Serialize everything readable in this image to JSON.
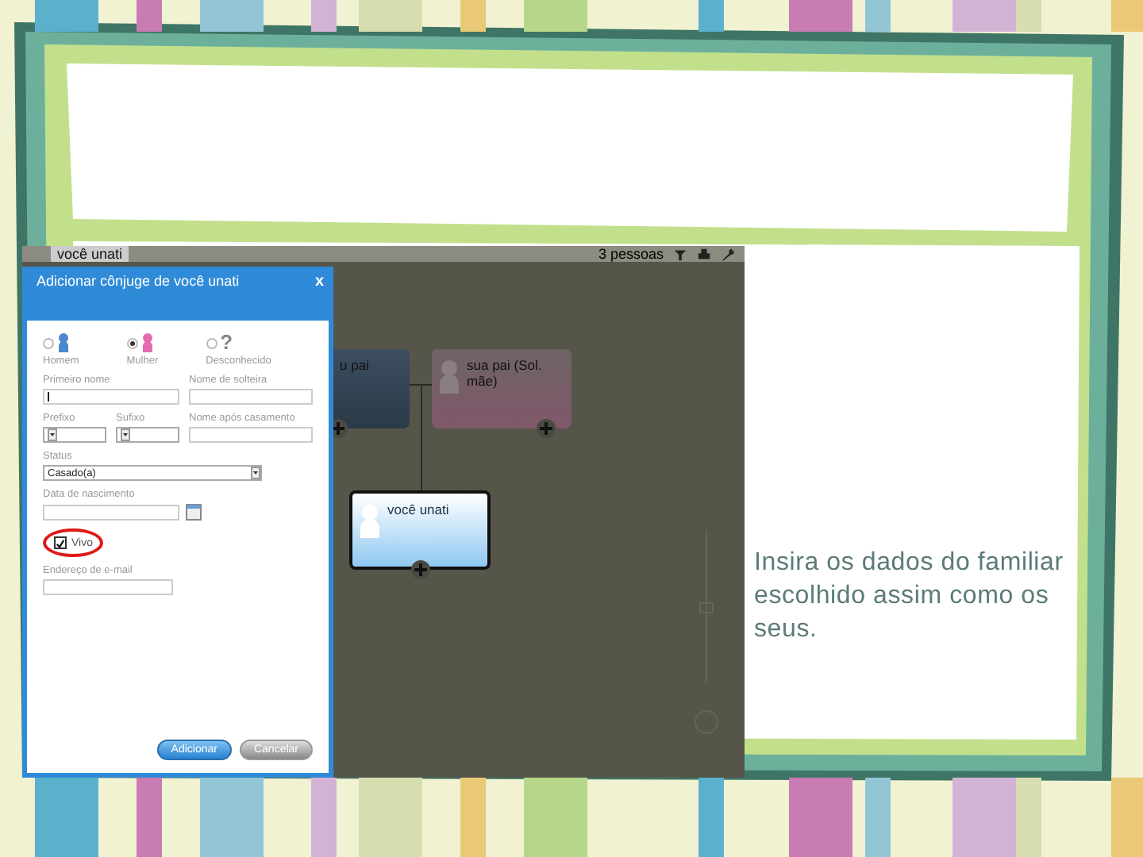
{
  "app": {
    "breadcrumb": "você unati",
    "people_count": "3 pessoas",
    "dialog": {
      "title": "Adicionar cônjuge de você unati",
      "close": "x",
      "genders": [
        {
          "label": "Homem",
          "kind": "male",
          "selected": false
        },
        {
          "label": "Mulher",
          "kind": "female",
          "selected": true
        },
        {
          "label": "Desconhecido",
          "kind": "unknown",
          "symbol": "?",
          "selected": false
        }
      ],
      "fields": [
        {
          "label": "Primeiro nome",
          "kind": "text",
          "focused": true
        },
        {
          "label": "Nome de solteira",
          "kind": "text"
        },
        {
          "label": "Prefixo",
          "kind": "select"
        },
        {
          "label": "Sufixo",
          "kind": "select"
        },
        {
          "label": "Nome após casamento",
          "kind": "text"
        },
        {
          "label": "Status",
          "kind": "select",
          "value": "Casado(a)"
        },
        {
          "label": "Data de nascimento",
          "kind": "date"
        },
        {
          "label": "Vivo",
          "kind": "checkbox",
          "checked": true,
          "highlighted": true
        },
        {
          "label": "Endereço de e-mail",
          "kind": "text"
        }
      ],
      "buttons": [
        {
          "label": "Adicionar",
          "kind": "primary"
        },
        {
          "label": "Cancelar",
          "kind": "secondary"
        }
      ]
    },
    "tree": {
      "nodes": [
        {
          "name": "u pai",
          "kind": "male"
        },
        {
          "name": "sua pai (Sol. mãe)",
          "kind": "female"
        },
        {
          "name": "você unati",
          "kind": "self"
        }
      ]
    }
  },
  "caption": "Insira os dados do familiar escolhido assim como os seus."
}
